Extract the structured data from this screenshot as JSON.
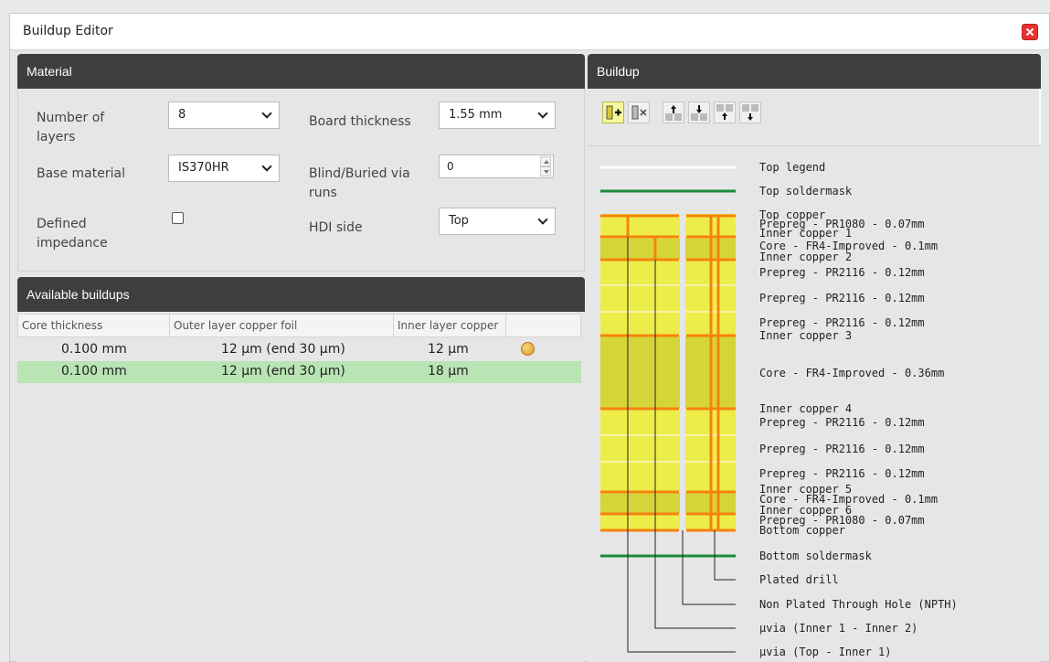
{
  "window": {
    "title": "Buildup Editor"
  },
  "material": {
    "header": "Material",
    "number_of_layers": {
      "label": "Number of layers",
      "value": "8"
    },
    "board_thickness": {
      "label": "Board thickness",
      "value": "1.55 mm"
    },
    "base_material": {
      "label": "Base material",
      "value": "IS370HR"
    },
    "blind_buried": {
      "label": "Blind/Buried via runs",
      "value": "0"
    },
    "defined_impedance": {
      "label": "Defined impedance",
      "checked": false
    },
    "hdi_side": {
      "label": "HDI side",
      "value": "Top"
    }
  },
  "available_buildups": {
    "header": "Available buildups",
    "columns": [
      "Core thickness",
      "Outer layer copper foil",
      "Inner layer copper"
    ],
    "rows": [
      {
        "core": "0.100 mm",
        "outer": "12 µm (end 30 µm)",
        "inner": "12 µm",
        "selected": false
      },
      {
        "core": "0.100 mm",
        "outer": "12 µm (end 30 µm)",
        "inner": "18 µm",
        "selected": true
      }
    ]
  },
  "buildup": {
    "header": "Buildup",
    "toolbar_icons": [
      "add-layer-icon",
      "remove-layer-icon",
      "move-up-icon",
      "move-down-icon",
      "insert-above-icon",
      "insert-below-icon"
    ],
    "stack_labels": {
      "top_legend": "Top legend",
      "top_soldermask": "Top soldermask",
      "top_copper": "Top copper",
      "prepreg_1080_top": "Prepreg - PR1080 - 0.07mm",
      "inner_copper_1": "Inner copper 1",
      "core_01_top": "Core - FR4-Improved - 0.1mm",
      "inner_copper_2": "Inner copper 2",
      "prepreg_a1": "Prepreg - PR2116 - 0.12mm",
      "prepreg_a2": "Prepreg - PR2116 - 0.12mm",
      "prepreg_a3": "Prepreg - PR2116 - 0.12mm",
      "inner_copper_3": "Inner copper 3",
      "core_036": "Core - FR4-Improved - 0.36mm",
      "inner_copper_4": "Inner copper 4",
      "prepreg_b1": "Prepreg - PR2116 - 0.12mm",
      "prepreg_b2": "Prepreg - PR2116 - 0.12mm",
      "prepreg_b3": "Prepreg - PR2116 - 0.12mm",
      "inner_copper_5": "Inner copper 5",
      "core_01_bottom": "Core - FR4-Improved - 0.1mm",
      "inner_copper_6": "Inner copper 6",
      "prepreg_1080_bottom": "Prepreg - PR1080 - 0.07mm",
      "bottom_copper": "Bottom copper",
      "bottom_soldermask": "Bottom soldermask",
      "plated_drill": "Plated drill",
      "npth": "Non Plated Through Hole (NPTH)",
      "uvia_inner": "µvia (Inner 1 - Inner 2)",
      "uvia_top": "µvia (Top - Inner 1)"
    }
  },
  "colors": {
    "header_bg": "#3e3e3e",
    "copper": "#f6820f",
    "prepreg": "#eded4a",
    "core": "#d5d53a",
    "soldermask": "#1a8c3a",
    "selected_row": "#b9e4b3"
  }
}
